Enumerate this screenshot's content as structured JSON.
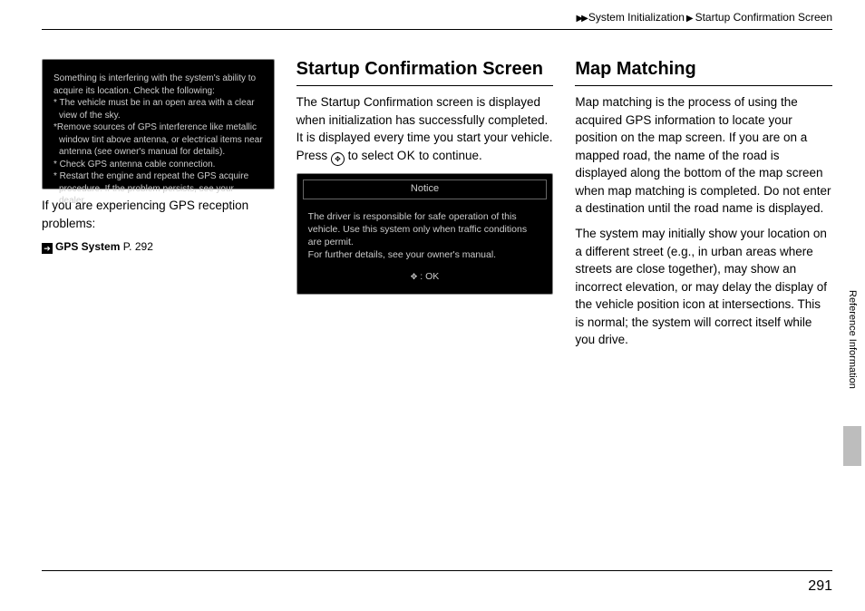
{
  "breadcrumb": {
    "level1": "System Initialization",
    "level2": "Startup Confirmation Screen"
  },
  "col1": {
    "screenshot": {
      "intro": "Something is interfering with the system's ability to acquire its location. Check the following:",
      "b1": "* The vehicle must be in an open area with a clear view of the sky.",
      "b2": "*Remove sources of GPS interference like metallic window tint above antenna, or electrical items near antenna (see owner's manual for details).",
      "b3": "* Check GPS antenna cable connection.",
      "b4": "* Restart the engine and repeat the GPS acquire procedure. If the problem persists, see your dealer."
    },
    "caption": "If you are experiencing GPS reception problems:",
    "ref_label": "GPS System",
    "ref_page": "P. 292"
  },
  "col2": {
    "title": "Startup Confirmation Screen",
    "body_pre": "The Startup Confirmation screen is displayed when initialization has successfully completed. It is displayed every time you start your vehicle. Press ",
    "body_mid": " to select ",
    "ok_word": "OK",
    "body_post": " to continue.",
    "notice": {
      "header": "Notice",
      "body": "The driver is responsible for safe operation of this vehicle. Use this system only when traffic conditions are permit.\nFor further details, see your owner's manual.",
      "ok": ": OK"
    }
  },
  "col3": {
    "title": "Map Matching",
    "p1": "Map matching is the process of using the acquired GPS information to locate your position on the map screen. If you are on a mapped road, the name of the road is displayed along the bottom of the map screen when map matching is completed. Do not enter a destination until the road name is displayed.",
    "p2": "The system may initially show your location on a different street (e.g., in urban areas where streets are close together), may show an incorrect elevation, or may delay the display of the vehicle position icon at intersections. This is normal; the system will correct itself while you drive."
  },
  "side_tab": "Reference Information",
  "page_number": "291"
}
